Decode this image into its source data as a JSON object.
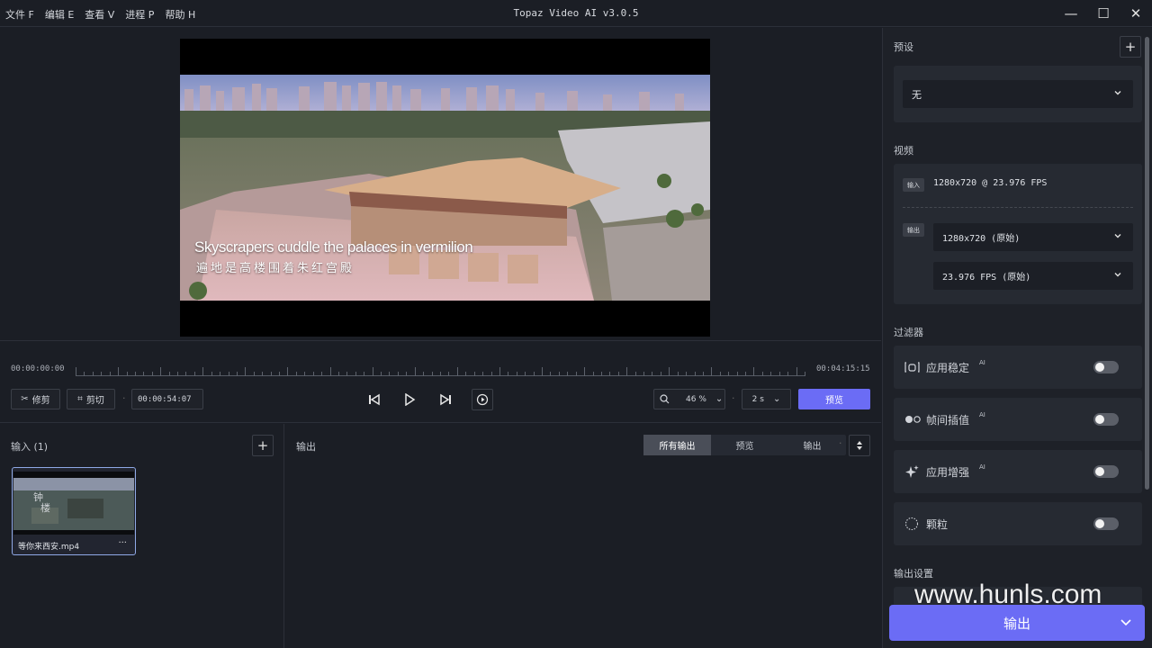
{
  "menu": [
    "文件 F",
    "编辑 E",
    "查看 V",
    "进程 P",
    "帮助 H"
  ],
  "app_title": "Topaz Video AI  v3.0.5",
  "window_controls": {
    "minimize": "—",
    "maximize": "☐",
    "close": "✕"
  },
  "preview": {
    "subtitle_en": "Skyscrapers cuddle the palaces in vermilion",
    "subtitle_cn": "遍地是高楼围着朱红宫殿"
  },
  "timeline": {
    "start": "00:00:00:00",
    "end": "00:04:15:15",
    "playhead_fraction": 0.211,
    "trim_label": "修剪",
    "cut_label": "剪切",
    "current_time": "00:00:54:07",
    "zoom": "46 %",
    "preview_duration": "2 s",
    "preview_button": "预览"
  },
  "input_pane": {
    "title": "输入 (1)",
    "file_name": "等你来西安.mp4",
    "more": "···"
  },
  "output_pane": {
    "title": "输出",
    "tabs": [
      "所有输出",
      "预览",
      "输出"
    ],
    "active_tab": 0
  },
  "sidebar": {
    "preset_title": "预设",
    "preset_value": "无",
    "video_title": "视频",
    "input_tag": "输入",
    "input_value": "1280x720 @ 23.976 FPS",
    "output_tag": "输出",
    "output_resolution": "1280x720 (原始)",
    "output_fps": "23.976 FPS (原始)",
    "filters_title": "过滤器",
    "filters": [
      {
        "label": "应用稳定",
        "ai": "AI",
        "icon": "stabilize-icon",
        "on": false
      },
      {
        "label": "帧间插值",
        "ai": "AI",
        "icon": "interpolation-icon",
        "on": false
      },
      {
        "label": "应用增强",
        "ai": "AI",
        "icon": "sparkle-icon",
        "on": false
      },
      {
        "label": "颗粒",
        "ai": "",
        "icon": "grain-icon",
        "on": false
      }
    ],
    "output_settings_title": "输出设置",
    "export_button": "输出"
  },
  "watermark": "www.hunls.com",
  "colors": {
    "accent": "#6b6cf5",
    "background": "#1b1e25",
    "panel": "#262a32"
  }
}
